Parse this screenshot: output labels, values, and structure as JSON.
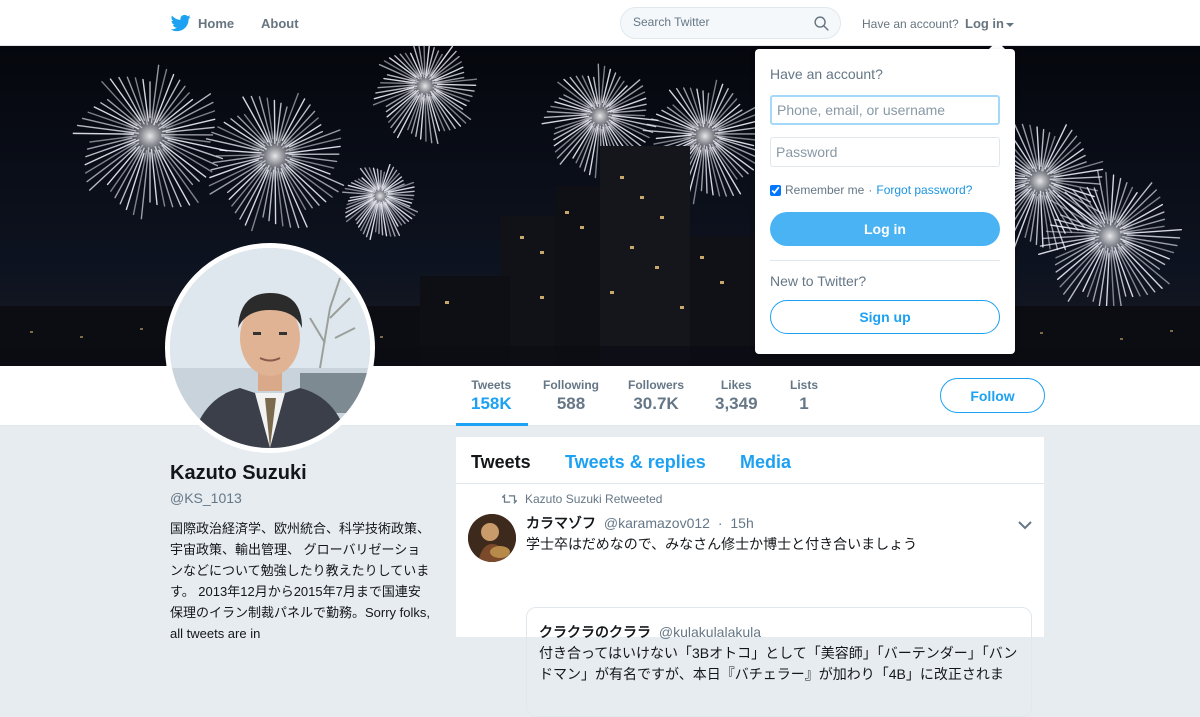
{
  "header": {
    "home_label": "Home",
    "about_label": "About",
    "search_placeholder": "Search Twitter",
    "have_account_text": "Have an account?",
    "login_label": "Log in"
  },
  "login_dropdown": {
    "title": "Have an account?",
    "username_placeholder": "Phone, email, or username",
    "password_placeholder": "Password",
    "remember_label": "Remember me",
    "separator": "·",
    "forgot_label": "Forgot password?",
    "login_button": "Log in",
    "new_text": "New to Twitter?",
    "signup_button": "Sign up"
  },
  "profile": {
    "name": "Kazuto Suzuki",
    "handle": "@KS_1013",
    "bio": "国際政治経済学、欧州統合、科学技術政策、宇宙政策、輸出管理、 グローバリゼーションなどについて勉強したり教えたりしています。 2013年12月から2015年7月まで国連安保理のイラン制裁パネルで勤務。Sorry folks, all tweets are in"
  },
  "stats": [
    {
      "label": "Tweets",
      "value": "158K",
      "active": true
    },
    {
      "label": "Following",
      "value": "588"
    },
    {
      "label": "Followers",
      "value": "30.7K"
    },
    {
      "label": "Likes",
      "value": "3,349"
    },
    {
      "label": "Lists",
      "value": "1"
    }
  ],
  "follow_button": "Follow",
  "timeline": {
    "tabs": [
      "Tweets",
      "Tweets & replies",
      "Media"
    ],
    "tweet": {
      "retweet_label": "Kazuto Suzuki Retweeted",
      "author_name": "カラマゾフ",
      "author_handle": "@karamazov012",
      "dot": "·",
      "time": "15h",
      "text": "学士卒はだめなので、みなさん修士か博士と付き合いましょう",
      "quote": {
        "author_name": "クラクラのクララ",
        "author_handle": "@kulakulalakula",
        "text": "付き合ってはいけない「3Bオトコ」として「美容師」「バーテンダー」「バンドマン」が有名ですが、本日『バチェラー』が加わり「4B」に改正されま"
      }
    }
  },
  "colors": {
    "brand": "#1da1f2",
    "login_button": "#4ab3f4",
    "text_secondary": "#657786"
  },
  "icons": [
    "twitter-bird-icon",
    "search-icon",
    "retweet-icon",
    "chevron-down-icon"
  ]
}
